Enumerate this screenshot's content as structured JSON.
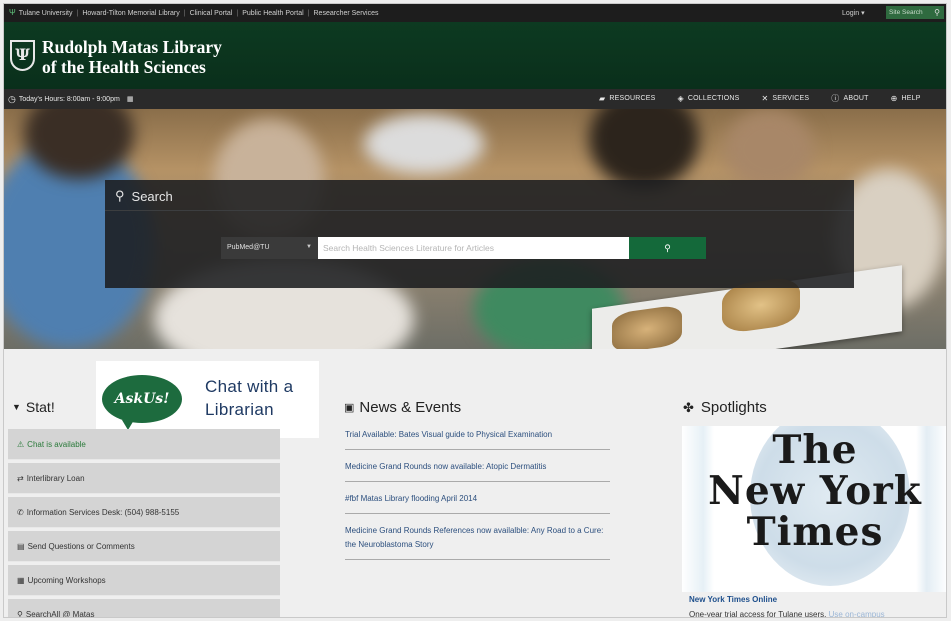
{
  "utility_bar": {
    "links": [
      "Tulane University",
      "Howard-Tilton Memorial Library",
      "Clinical Portal",
      "Public Health Portal",
      "Researcher Services"
    ],
    "login": "Login ▾",
    "site_search_label": "Site Search"
  },
  "header": {
    "title_line1": "Rudolph Matas Library",
    "title_line2": "of the Health Sciences"
  },
  "nav_bar": {
    "hours": "Today's Hours:  8:00am - 9:00pm",
    "items": [
      {
        "label": "RESOURCES",
        "icon": "book-icon"
      },
      {
        "label": "COLLECTIONS",
        "icon": "collections-icon"
      },
      {
        "label": "SERVICES",
        "icon": "tools-icon"
      },
      {
        "label": "ABOUT",
        "icon": "info-icon"
      },
      {
        "label": "HELP",
        "icon": "lifebuoy-icon"
      }
    ]
  },
  "search": {
    "title": "Search",
    "database_selected": "PubMed@TU",
    "placeholder": "Search Health Sciences Literature for Articles"
  },
  "chat_widget": {
    "badge": "AskUs!",
    "line1": "Chat with a",
    "line2": "Librarian"
  },
  "stat": {
    "title": "Stat!",
    "items": [
      {
        "label": "Chat is available",
        "icon": "chat-icon"
      },
      {
        "label": "Interlibrary Loan",
        "icon": "exchange-icon"
      },
      {
        "label": "Information Services Desk: (504) 988-5155",
        "icon": "phone-icon"
      },
      {
        "label": "Send Questions or Comments",
        "icon": "document-icon"
      },
      {
        "label": "Upcoming Workshops",
        "icon": "calendar-icon"
      },
      {
        "label": "SearchAll @ Matas",
        "icon": "search-icon"
      }
    ]
  },
  "news": {
    "title": "News & Events",
    "items": [
      "Trial Available: Bates Visual guide to Physical Examination",
      "Medicine Grand Rounds now available: Atopic Dermatitis",
      "#fbf Matas Library flooding April 2014",
      "Medicine Grand Rounds References now availalble: Any Road to a Cure: the Neuroblastoma Story"
    ]
  },
  "spotlights": {
    "title": "Spotlights",
    "logo_line1": "The",
    "logo_line2": "New York",
    "logo_line3": "Times",
    "link": "New York Times Online",
    "description": "One-year trial access for Tulane users.",
    "more": "Use on-campus"
  },
  "colors": {
    "header_green": "#0d3a21",
    "accent_green": "#14693a",
    "link_blue": "#2c4f7e"
  }
}
